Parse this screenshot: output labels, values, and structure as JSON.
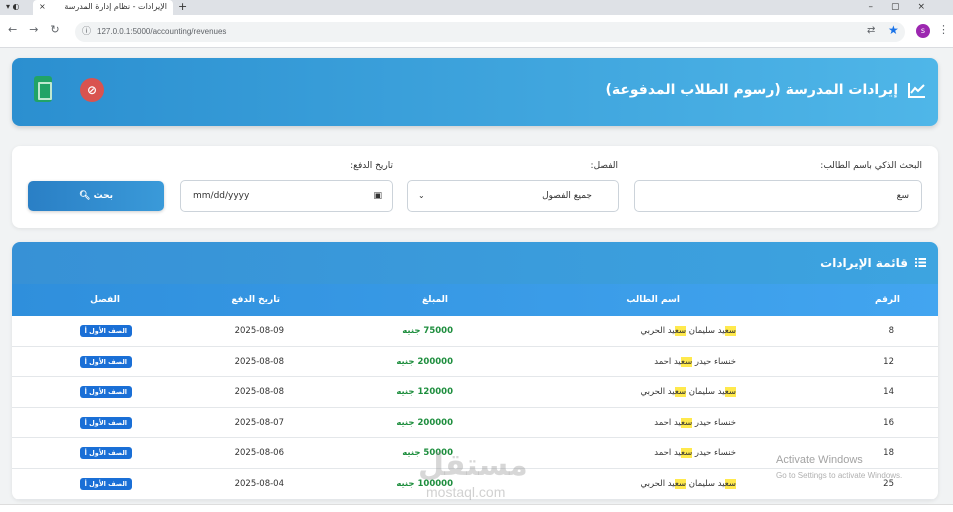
{
  "browser": {
    "tab_title": "الإيرادات - نظام إدارة المدرسة",
    "tab_close": "×",
    "new_tab": "+",
    "url": "127.0.0.1:5000/accounting/revenues"
  },
  "header": {
    "title": "إيرادات المدرسة (رسوم الطلاب المدفوعة)",
    "icons": [
      "chart-line-icon",
      "pdf-icon",
      "excel-icon"
    ]
  },
  "filters": {
    "student_label": "البحث الذكي باسم الطالب:",
    "student_value": "سع",
    "class_label": "الفصل:",
    "class_value": "جميع الفصول",
    "date_label": "تاريخ الدفع:",
    "date_placeholder": "mm/dd/yyyy",
    "search_button": "بحث"
  },
  "list": {
    "title": "قائمة الإيرادات",
    "columns": [
      "الرقم",
      "اسم الطالب",
      "المبلغ",
      "تاريخ الدفع",
      "الفصل"
    ],
    "rows": [
      {
        "id": "8",
        "name_pre": "",
        "name_hl1": "سع",
        "name_mid": "يد سليمان ",
        "name_hl2": "سع",
        "name_post": "يد الحربي",
        "amount": "75000 جنيه",
        "date": "2025-08-09",
        "class": "الصف الأول أ"
      },
      {
        "id": "12",
        "name_pre": "خنساء حيدر ",
        "name_hl1": "سع",
        "name_mid": "يد احمد",
        "name_hl2": "",
        "name_post": "",
        "amount": "200000 جنيه",
        "date": "2025-08-08",
        "class": "الصف الأول أ"
      },
      {
        "id": "14",
        "name_pre": "",
        "name_hl1": "سع",
        "name_mid": "يد سليمان ",
        "name_hl2": "سع",
        "name_post": "يد الحربي",
        "amount": "120000 جنيه",
        "date": "2025-08-08",
        "class": "الصف الأول أ"
      },
      {
        "id": "16",
        "name_pre": "خنساء حيدر ",
        "name_hl1": "سع",
        "name_mid": "يد احمد",
        "name_hl2": "",
        "name_post": "",
        "amount": "200000 جنيه",
        "date": "2025-08-07",
        "class": "الصف الأول أ"
      },
      {
        "id": "18",
        "name_pre": "خنساء حيدر ",
        "name_hl1": "سع",
        "name_mid": "يد احمد",
        "name_hl2": "",
        "name_post": "",
        "amount": "50000 جنيه",
        "date": "2025-08-06",
        "class": "الصف الأول أ"
      },
      {
        "id": "25",
        "name_pre": "",
        "name_hl1": "سع",
        "name_mid": "يد سليمان ",
        "name_hl2": "سع",
        "name_post": "يد الحربي",
        "amount": "100000 جنيه",
        "date": "2025-08-04",
        "class": "الصف الأول أ"
      }
    ]
  },
  "watermarks": {
    "activate_title": "Activate Windows",
    "activate_sub": "Go to Settings to activate Windows.",
    "mostaql": "مستقل",
    "mostaql_sub": "mostaql.com"
  },
  "colors": {
    "primary": "#2b8fd0",
    "amount": "#1e8e3e",
    "badge": "#1a6fd6",
    "highlight": "#ffe94d"
  }
}
